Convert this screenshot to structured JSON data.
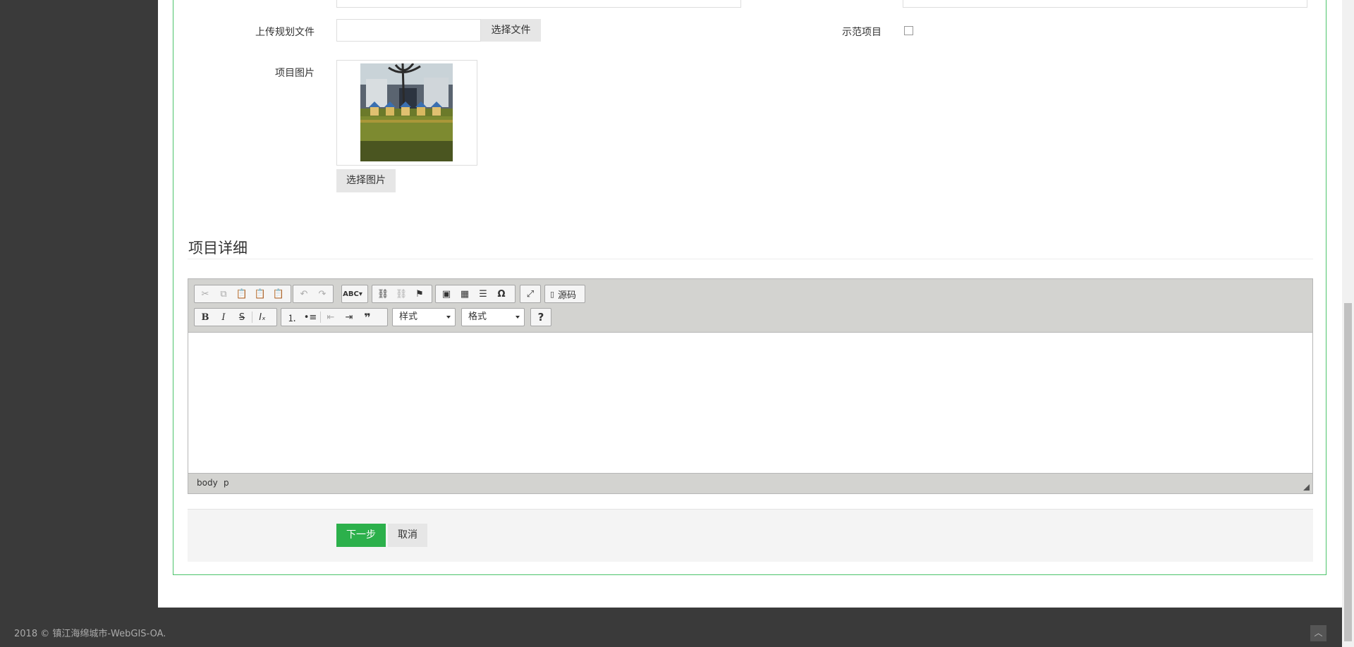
{
  "form": {
    "upload_label": "上传规划文件",
    "choose_file_label": "选择文件",
    "demo_label": "示范项目",
    "demo_checked": false,
    "image_label": "项目图片",
    "choose_image_label": "选择图片"
  },
  "section": {
    "title": "项目详细"
  },
  "editor": {
    "toolbar_row1": [
      "cut-icon",
      "copy-icon",
      "paste-icon",
      "paste-text-icon",
      "paste-word-icon",
      "undo-icon",
      "redo-icon",
      "spellcheck-icon",
      "link-icon",
      "unlink-icon",
      "anchor-icon",
      "image-icon",
      "table-icon",
      "horizontal-rule-icon",
      "special-char-icon",
      "maximize-icon",
      "source-icon"
    ],
    "source_label": "源码",
    "styles_label": "样式",
    "format_label": "格式",
    "help_label": "?",
    "path": [
      "body",
      "p"
    ]
  },
  "actions": {
    "next_label": "下一步",
    "cancel_label": "取消"
  },
  "footer": {
    "copyright": "2018 © 镇江海绵城市-WebGIS-OA."
  },
  "colors": {
    "accent_green": "#2cb04b",
    "panel_border": "#4cc46a",
    "sidebar": "#3a3a3a"
  }
}
